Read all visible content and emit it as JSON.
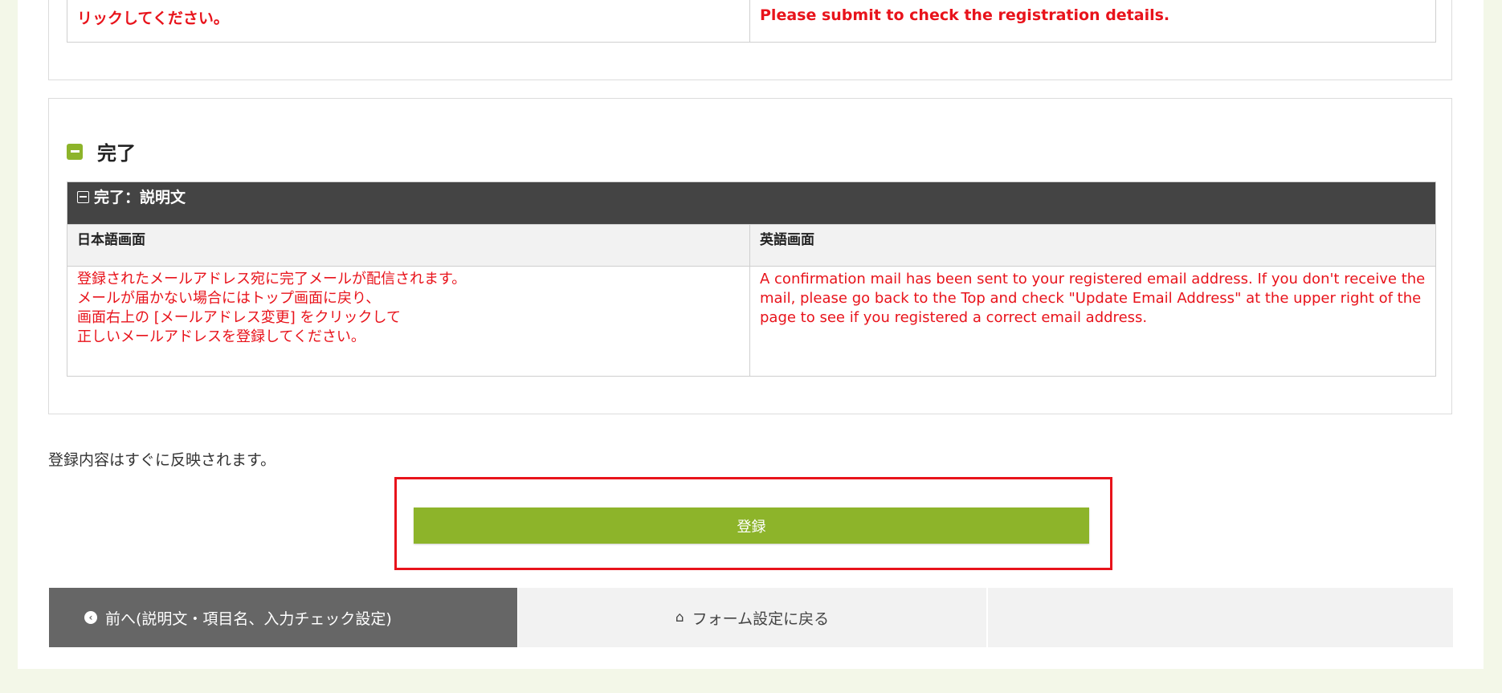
{
  "top_section": {
    "ja_text": "リックしてください。",
    "en_text": "Please submit to check the registration details."
  },
  "complete_section": {
    "heading": "完了",
    "table_title": "完了：説明文",
    "col_ja": "日本語画面",
    "col_en": "英語画面",
    "ja_lines": [
      "登録されたメールアドレス宛に完了メールが配信されます。",
      "メールが届かない場合にはトップ画面に戻り、",
      "画面右上の [メールアドレス変更] をクリックして",
      "正しいメールアドレスを登録してください。"
    ],
    "en_text": "A confirmation mail has been sent to your registered email address. If you don't receive the mail, please go back to the Top and check \"Update Email Address\" at the upper right of the page to see if you registered a correct email address."
  },
  "note": "登録内容はすぐに反映されます。",
  "submit_label": "登録",
  "footer": {
    "prev_label": "前へ(説明文・項目名、入力チェック設定)",
    "home_label": "フォーム設定に戻る"
  },
  "icons": {
    "section_icon": "minus-square-icon",
    "table_icon": "collapse-box-icon",
    "prev_icon": "chevron-left-circle-icon",
    "home_icon": "home-icon"
  },
  "colors": {
    "accent_green": "#8db42a",
    "warning_red": "#e8131b",
    "dark_header": "#444444"
  }
}
